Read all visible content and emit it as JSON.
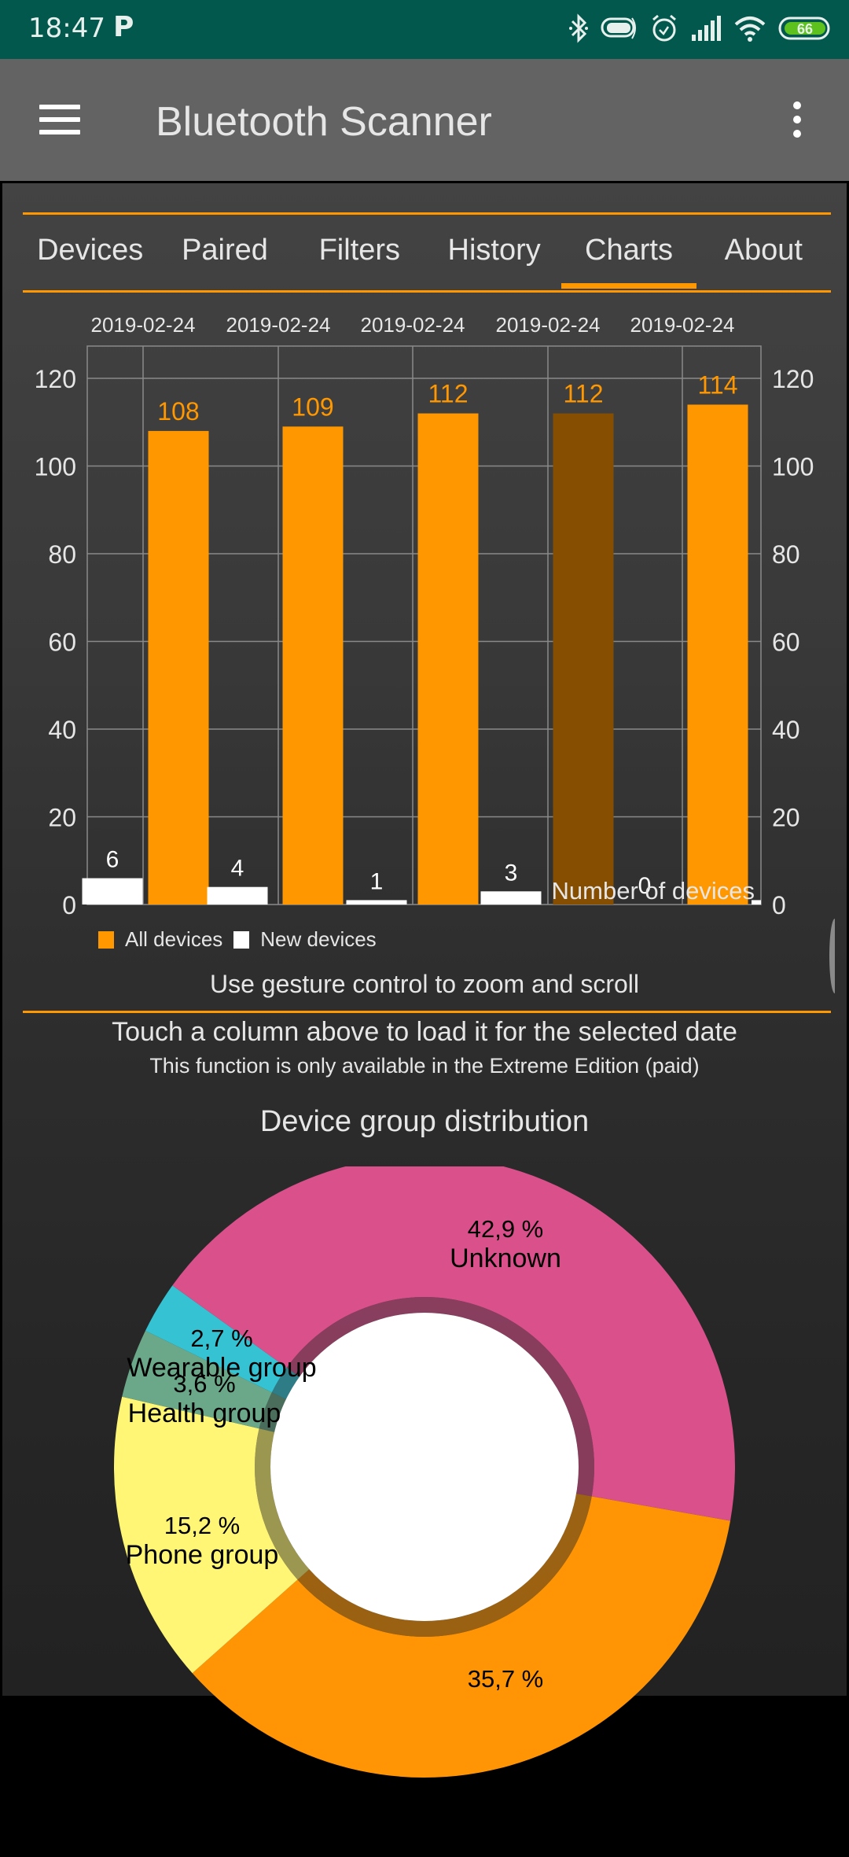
{
  "status_bar": {
    "time": "18:47",
    "notification_icon": "parking-p-icon",
    "icons": [
      "bluetooth-icon",
      "vibrate-icon",
      "alarm-icon",
      "signal-icon",
      "wifi-icon",
      "battery-icon"
    ],
    "battery_level": "66",
    "battery_color": "#5dc21e"
  },
  "app_bar": {
    "title": "Bluetooth Scanner",
    "menu_icon": "hamburger-menu-icon",
    "overflow_icon": "more-vert-icon"
  },
  "tabs": [
    {
      "label": "Devices",
      "active": false
    },
    {
      "label": "Paired",
      "active": false
    },
    {
      "label": "Filters",
      "active": false
    },
    {
      "label": "History",
      "active": false
    },
    {
      "label": "Charts",
      "active": true
    },
    {
      "label": "About",
      "active": false
    }
  ],
  "accent_color": "#ff9800",
  "bar_chart": {
    "legend": {
      "all": "All devices",
      "new": "New devices"
    },
    "hint": "Use gesture control to zoom and scroll"
  },
  "touch_hint": {
    "title": "Touch a column above to load it for the selected date",
    "subtitle": "This function is only available in the Extreme Edition (paid)"
  },
  "chart_data": [
    {
      "type": "bar",
      "title": "",
      "xlabel": "",
      "ylabel": "",
      "description": "Number of devices",
      "categories": [
        "",
        "2019-02-24",
        "2019-02-24",
        "2019-02-24",
        "2019-02-24",
        "2019-02-24"
      ],
      "top_labels": [
        "2019-02-24",
        "2019-02-24",
        "2019-02-24",
        "2019-02-24",
        "2019-02-24"
      ],
      "series": [
        {
          "name": "All devices",
          "color": "#ff9800",
          "values": [
            null,
            108,
            109,
            112,
            112,
            114
          ],
          "highlighted_index": 4,
          "highlight_color": "#864e00"
        },
        {
          "name": "New devices",
          "color": "#ffffff",
          "values": [
            6,
            4,
            1,
            3,
            0,
            1
          ]
        }
      ],
      "visible_value_labels": {
        "all": [
          "108",
          "109",
          "112",
          "112",
          "114"
        ],
        "new": [
          "6",
          "4",
          "1",
          "3",
          "0"
        ]
      },
      "overlay_label": "Number of devices",
      "yticks": [
        0,
        20,
        40,
        60,
        80,
        100,
        120
      ],
      "ylim": [
        0,
        127
      ],
      "grid": true,
      "dual_y_axis": true,
      "legend_position": "bottom-left"
    },
    {
      "type": "pie",
      "title": "Device group distribution",
      "donut": true,
      "slices": [
        {
          "label": "Unknown",
          "value": 42.9,
          "display": "42,9 %",
          "color": "#d9508b"
        },
        {
          "label": "",
          "value": 35.7,
          "display": "35,7 %",
          "color": "#ff9505"
        },
        {
          "label": "Phone group",
          "value": 15.2,
          "display": "15,2 %",
          "color": "#fff675"
        },
        {
          "label": "Health group",
          "value": 3.6,
          "display": "3,6 %",
          "color": "#6aa889"
        },
        {
          "label": "Wearable group",
          "value": 2.7,
          "display": "2,7 %",
          "color": "#35c3d3"
        }
      ]
    }
  ]
}
